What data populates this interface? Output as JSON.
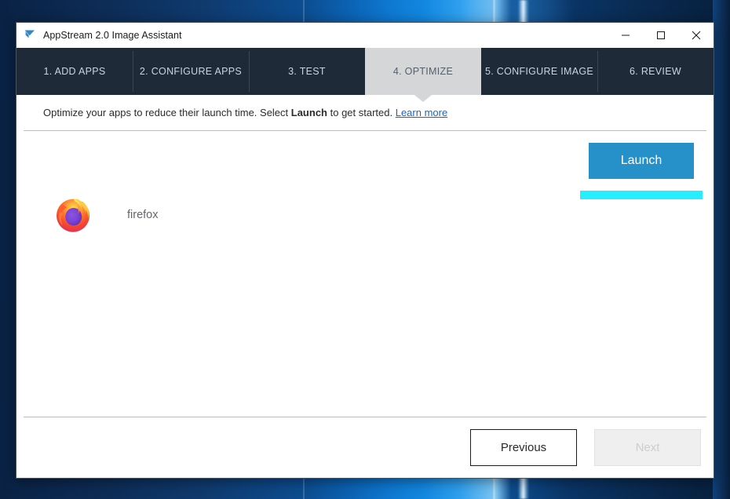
{
  "window": {
    "title": "AppStream 2.0 Image Assistant",
    "app_icon": "appstream-logo-icon",
    "controls": {
      "minimize": "minimize-icon",
      "maximize": "maximize-icon",
      "close": "close-icon"
    }
  },
  "tabs": [
    {
      "label": "1. ADD APPS",
      "active": false
    },
    {
      "label": "2. CONFIGURE APPS",
      "active": false
    },
    {
      "label": "3. TEST",
      "active": false
    },
    {
      "label": "4. OPTIMIZE",
      "active": true
    },
    {
      "label": "5. CONFIGURE IMAGE",
      "active": false
    },
    {
      "label": "6. REVIEW",
      "active": false
    }
  ],
  "instruction": {
    "text_before": "Optimize your apps to reduce their launch time. Select ",
    "emphasis": "Launch",
    "text_after": " to get started. ",
    "link": "Learn more"
  },
  "main": {
    "launch_label": "Launch",
    "apps": [
      {
        "name": "firefox",
        "icon": "firefox-icon"
      }
    ]
  },
  "footer": {
    "previous_label": "Previous",
    "next_label": "Next",
    "next_disabled": true
  },
  "colors": {
    "tab_bar": "#1e2a38",
    "active_tab": "#d4d6d8",
    "launch_button": "#2691c9",
    "highlight_bar": "#25efff",
    "link": "#1a63c7"
  }
}
